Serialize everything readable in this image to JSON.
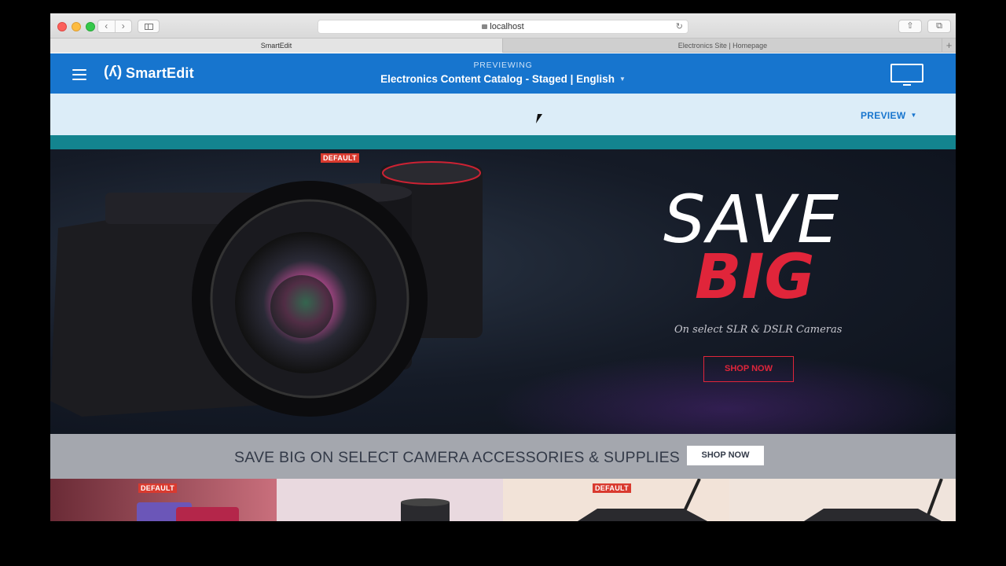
{
  "browser": {
    "url": "localhost",
    "tabs": [
      {
        "label": "SmartEdit"
      },
      {
        "label": "Electronics Site | Homepage"
      }
    ],
    "new_tab": "+"
  },
  "smartedit": {
    "logo_mark": "(ʎ)",
    "logo_text": "SmartEdit",
    "previewing_label": "PREVIEWING",
    "catalog": "Electronics Content Catalog - Staged | English",
    "preview_button": "PREVIEW"
  },
  "hero": {
    "default_label": "DEFAULT",
    "headline_1": "SAVE",
    "headline_2": "BIG",
    "subtitle": "On select SLR & DSLR Cameras",
    "cta": "SHOP NOW"
  },
  "banner": {
    "text": "SAVE BIG ON SELECT CAMERA ACCESSORIES & SUPPLIES",
    "cta": "SHOP NOW"
  },
  "tiles": [
    {
      "badge": "DEFAULT"
    },
    {
      "badge": ""
    },
    {
      "badge": "DEFAULT"
    },
    {
      "badge": ""
    }
  ],
  "colors": {
    "smartedit_blue": "#1775ce",
    "preview_bar": "#dcedf8",
    "teal": "#13848f",
    "accent_red": "#e0253a"
  }
}
